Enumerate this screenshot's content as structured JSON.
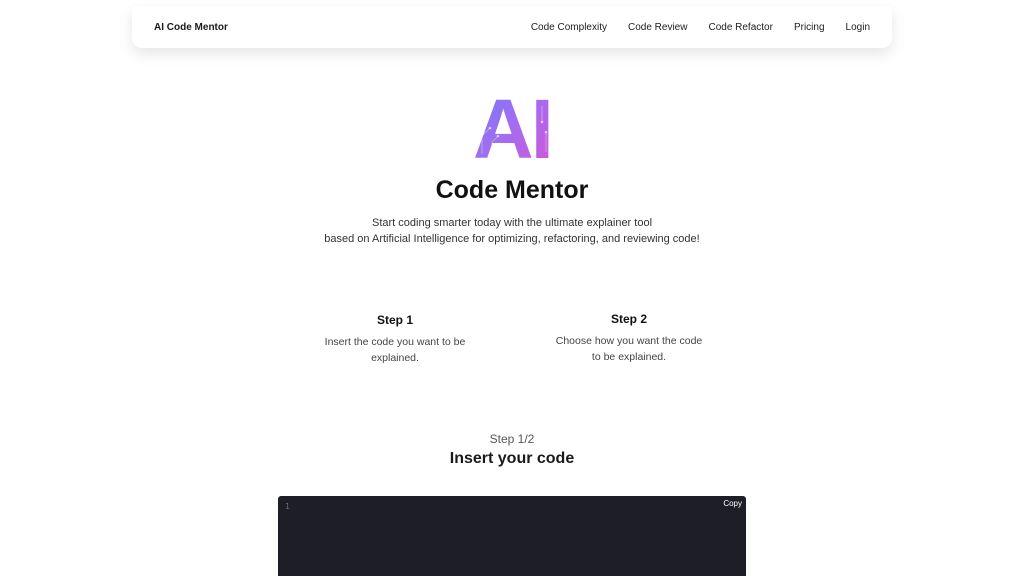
{
  "nav": {
    "brand": "AI Code Mentor",
    "links": [
      "Code Complexity",
      "Code Review",
      "Code Refactor",
      "Pricing",
      "Login"
    ]
  },
  "hero": {
    "logo_text": "AI",
    "title": "Code Mentor",
    "subtitle_line1": "Start coding smarter today with the ultimate explainer tool",
    "subtitle_line2": "based on Artificial Intelligence for optimizing, refactoring, and reviewing code!"
  },
  "steps": [
    {
      "title": "Step 1",
      "description": "Insert the code you want to be explained."
    },
    {
      "title": "Step 2",
      "description": "Choose how you want the code to be explained."
    }
  ],
  "insert_section": {
    "counter": "Step 1/2",
    "title": "Insert your code"
  },
  "editor": {
    "line_number": "1",
    "copy_label": "Copy"
  },
  "colors": {
    "logo_gradient": [
      "#7b6cf6",
      "#a76cf0",
      "#d05ad8"
    ],
    "editor_background": "#1e1f26"
  }
}
